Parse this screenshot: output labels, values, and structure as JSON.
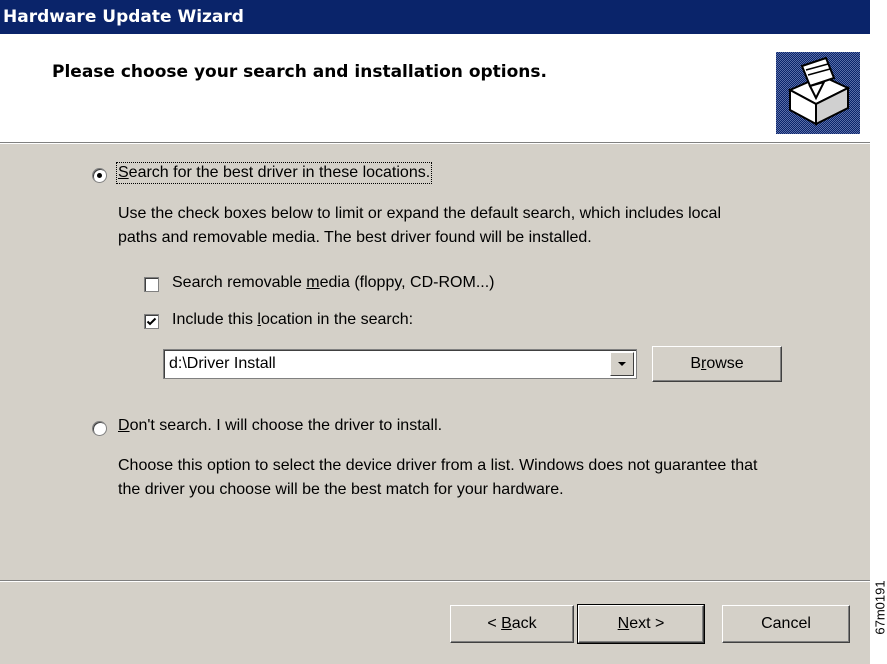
{
  "window": {
    "title": "Hardware Update Wizard",
    "header_title": "Please choose your search and installation options."
  },
  "option_search": {
    "label_pre": "",
    "label_key": "S",
    "label_post": "earch for the best driver in these locations.",
    "selected": true,
    "description_line1": "Use the check boxes below to limit or expand the default search, which includes local",
    "description_line2": "paths and removable media. The best driver found will be installed."
  },
  "checkbox_removable": {
    "label_pre": "Search removable ",
    "label_key": "m",
    "label_post": "edia (floppy, CD-ROM...)",
    "checked": false
  },
  "checkbox_location": {
    "label_pre": "Include this ",
    "label_key": "l",
    "label_post": "ocation in the search:",
    "checked": true
  },
  "location_combo": {
    "value": "d:\\Driver Install"
  },
  "browse_button": {
    "label_pre": "B",
    "label_key": "r",
    "label_post": "owse"
  },
  "option_dont_search": {
    "label_pre": "",
    "label_key": "D",
    "label_post": "on't search. I will choose the driver to install.",
    "selected": false,
    "description_line1": "Choose this option to select the device driver from a list.  Windows does not guarantee that",
    "description_line2": "the driver you choose will be the best match for your hardware."
  },
  "footer": {
    "back_pre": "< ",
    "back_key": "B",
    "back_post": "ack",
    "next_pre": "",
    "next_key": "N",
    "next_post": "ext >",
    "cancel_label": "Cancel"
  },
  "figure_id": "67m0191",
  "colors": {
    "titlebar": "#0a246a",
    "face": "#d4d0c8",
    "header_bg": "#ffffff"
  }
}
